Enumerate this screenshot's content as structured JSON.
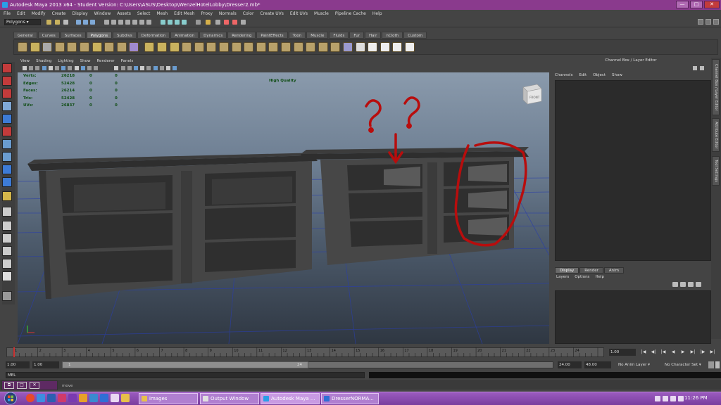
{
  "window": {
    "title": "Autodesk Maya 2013 x64 - Student Version: C:\\Users\\ASUS\\Desktop\\WenzelHotelLobby\\Dresser2.mb*",
    "controls": [
      "—",
      "□",
      "✕"
    ]
  },
  "menubar": [
    "File",
    "Edit",
    "Modify",
    "Create",
    "Display",
    "Window",
    "Assets",
    "Select",
    "Mesh",
    "Edit Mesh",
    "Proxy",
    "Normals",
    "Color",
    "Create UVs",
    "Edit UVs",
    "Muscle",
    "Pipeline Cache",
    "Help"
  ],
  "status": {
    "mode": "Polygons"
  },
  "shelf": {
    "tabs": [
      "General",
      "Curves",
      "Surfaces",
      "Polygons",
      "Subdivs",
      "Deformation",
      "Animation",
      "Dynamics",
      "Rendering",
      "PaintEffects",
      "Toon",
      "Muscle",
      "Fluids",
      "Fur",
      "Hair",
      "nCloth",
      "Custom"
    ],
    "active": "Polygons"
  },
  "panel": {
    "menu": [
      "View",
      "Shading",
      "Lighting",
      "Show",
      "Renderer",
      "Panels"
    ]
  },
  "hud": {
    "rows": [
      {
        "label": "Verts:",
        "v1": "26218",
        "v2": "0",
        "v3": "0"
      },
      {
        "label": "Edges:",
        "v1": "52428",
        "v2": "0",
        "v3": "0"
      },
      {
        "label": "Faces:",
        "v1": "26214",
        "v2": "0",
        "v3": "0"
      },
      {
        "label": "Tris:",
        "v1": "52428",
        "v2": "0",
        "v3": "0"
      },
      {
        "label": "UVs:",
        "v1": "26837",
        "v2": "0",
        "v3": "0"
      }
    ],
    "quality": "High Quality",
    "viewcube_label": "FRONT",
    "annotation": "? ?"
  },
  "channelbox": {
    "title": "Channel Box / Layer Editor",
    "menu": [
      "Channels",
      "Edit",
      "Object",
      "Show"
    ]
  },
  "sidetabs": [
    "Channel Box / Layer Editor",
    "Attribute Editor",
    "Tool Settings"
  ],
  "layereditor": {
    "tabs": [
      "Display",
      "Render",
      "Anim"
    ],
    "active": "Display",
    "menu": [
      "Layers",
      "Options",
      "Help"
    ]
  },
  "timeline": {
    "ticks": [
      "1",
      "2",
      "3",
      "4",
      "5",
      "6",
      "7",
      "8",
      "9",
      "10",
      "11",
      "12",
      "13",
      "14",
      "15",
      "16",
      "17",
      "18",
      "19",
      "20",
      "21",
      "22",
      "23",
      "24"
    ],
    "current": "1.00",
    "playback": [
      "|◀",
      "◀|",
      "|◀",
      "◀",
      "▶",
      "▶|",
      "|▶",
      "▶|"
    ]
  },
  "range": {
    "start": "1.00",
    "start2": "1.00",
    "handle_start": "1",
    "handle_end": "24",
    "end": "24.00",
    "end2": "48.00",
    "anim_layer": "No Anim Layer",
    "char_set": "No Character Set"
  },
  "command": {
    "lang": "MEL",
    "help": "move"
  },
  "taskbar": {
    "tasks": [
      {
        "label": "images",
        "color": "#e8c04a"
      },
      {
        "label": "Output Window",
        "color": "#e0e0e0"
      },
      {
        "label": "Autodesk Maya ...",
        "color": "#2a9ee8"
      },
      {
        "label": "DresserNORMA...",
        "color": "#2f6fd6"
      }
    ],
    "clock": "11:26 PM"
  }
}
